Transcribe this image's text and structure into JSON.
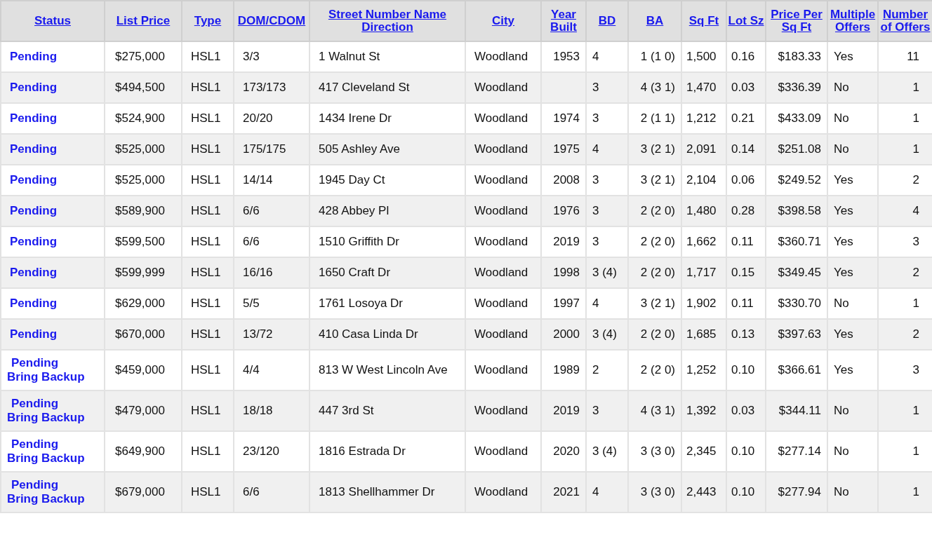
{
  "table": {
    "columns": [
      "Status",
      "List Price",
      "Type",
      "DOM/CDOM",
      "Street Number Name Direction",
      "City",
      "Year Built",
      "BD",
      "BA",
      "Sq Ft",
      "Lot Sz",
      "Price Per Sq Ft",
      "Multiple Offers",
      "Number of Offers"
    ],
    "rows": [
      [
        "Pending",
        "$275,000",
        "HSL1",
        "3/3",
        "1 Walnut St",
        "Woodland",
        "1953",
        "4",
        "1 (1 0)",
        "1,500",
        "0.16",
        "$183.33",
        "Yes",
        "11"
      ],
      [
        "Pending",
        "$494,500",
        "HSL1",
        "173/173",
        "417 Cleveland St",
        "Woodland",
        null,
        "3",
        "4 (3 1)",
        "1,470",
        "0.03",
        "$336.39",
        "No",
        "1"
      ],
      [
        "Pending",
        "$524,900",
        "HSL1",
        "20/20",
        "1434 Irene Dr",
        "Woodland",
        "1974",
        "3",
        "2 (1 1)",
        "1,212",
        "0.21",
        "$433.09",
        "No",
        "1"
      ],
      [
        "Pending",
        "$525,000",
        "HSL1",
        "175/175",
        "505 Ashley Ave",
        "Woodland",
        "1975",
        "4",
        "3 (2 1)",
        "2,091",
        "0.14",
        "$251.08",
        "No",
        "1"
      ],
      [
        "Pending",
        "$525,000",
        "HSL1",
        "14/14",
        "1945 Day Ct",
        "Woodland",
        "2008",
        "3",
        "3 (2 1)",
        "2,104",
        "0.06",
        "$249.52",
        "Yes",
        "2"
      ],
      [
        "Pending",
        "$589,900",
        "HSL1",
        "6/6",
        "428 Abbey Pl",
        "Woodland",
        "1976",
        "3",
        "2 (2 0)",
        "1,480",
        "0.28",
        "$398.58",
        "Yes",
        "4"
      ],
      [
        "Pending",
        "$599,500",
        "HSL1",
        "6/6",
        "1510 Griffith Dr",
        "Woodland",
        "2019",
        "3",
        "2 (2 0)",
        "1,662",
        "0.11",
        "$360.71",
        "Yes",
        "3"
      ],
      [
        "Pending",
        "$599,999",
        "HSL1",
        "16/16",
        "1650 Craft Dr",
        "Woodland",
        "1998",
        "3 (4)",
        "2 (2 0)",
        "1,717",
        "0.15",
        "$349.45",
        "Yes",
        "2"
      ],
      [
        "Pending",
        "$629,000",
        "HSL1",
        "5/5",
        "1761 Losoya Dr",
        "Woodland",
        "1997",
        "4",
        "3 (2 1)",
        "1,902",
        "0.11",
        "$330.70",
        "No",
        "1"
      ],
      [
        "Pending",
        "$670,000",
        "HSL1",
        "13/72",
        "410 Casa Linda Dr",
        "Woodland",
        "2000",
        "3 (4)",
        "2 (2 0)",
        "1,685",
        "0.13",
        "$397.63",
        "Yes",
        "2"
      ],
      [
        "Pending Bring Backup",
        "$459,000",
        "HSL1",
        "4/4",
        "813 W West Lincoln Ave",
        "Woodland",
        "1989",
        "2",
        "2 (2 0)",
        "1,252",
        "0.10",
        "$366.61",
        "Yes",
        "3"
      ],
      [
        "Pending Bring Backup",
        "$479,000",
        "HSL1",
        "18/18",
        "447 3rd St",
        "Woodland",
        "2019",
        "3",
        "4 (3 1)",
        "1,392",
        "0.03",
        "$344.11",
        "No",
        "1"
      ],
      [
        "Pending Bring Backup",
        "$649,900",
        "HSL1",
        "23/120",
        "1816 Estrada Dr",
        "Woodland",
        "2020",
        "3 (4)",
        "3 (3 0)",
        "2,345",
        "0.10",
        "$277.14",
        "No",
        "1"
      ],
      [
        "Pending Bring Backup",
        "$679,000",
        "HSL1",
        "6/6",
        "1813 Shellhammer Dr",
        "Woodland",
        "2021",
        "4",
        "3 (3 0)",
        "2,443",
        "0.10",
        "$277.94",
        "No",
        "1"
      ]
    ]
  }
}
